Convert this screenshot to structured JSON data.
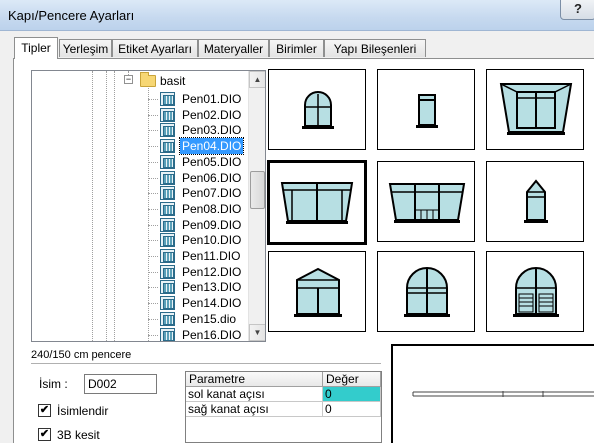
{
  "window": {
    "title": "Kapı/Pencere Ayarları",
    "help_label": "?"
  },
  "tabs": [
    {
      "label": "Tipler",
      "active": true
    },
    {
      "label": "Yerleşim"
    },
    {
      "label": "Etiket Ayarları"
    },
    {
      "label": "Materyaller"
    },
    {
      "label": "Birimler"
    },
    {
      "label": "Yapı Bileşenleri"
    }
  ],
  "tree": {
    "folder": {
      "label": "basit",
      "expander": "−"
    },
    "items": [
      "Pen01.DIO",
      "Pen02.DIO",
      "Pen03.DIO",
      "Pen04.DIO",
      "Pen05.DIO",
      "Pen06.DIO",
      "Pen07.DIO",
      "Pen08.DIO",
      "Pen09.DIO",
      "Pen10.DIO",
      "Pen11.DIO",
      "Pen12.DIO",
      "Pen13.DIO",
      "Pen14.DIO",
      "Pen15.dio",
      "Pen16.DIO"
    ],
    "selected_index": 3,
    "scroll_up": "▲",
    "scroll_down": "▼"
  },
  "thumbnails": [
    {
      "icon": "arched-window-small-icon"
    },
    {
      "icon": "small-window-icon"
    },
    {
      "icon": "bay-window-icon"
    },
    {
      "icon": "double-window-icon",
      "selected": true
    },
    {
      "icon": "triple-window-icon"
    },
    {
      "icon": "gabled-narrow-window-icon"
    },
    {
      "icon": "gabled-wide-window-icon"
    },
    {
      "icon": "arched-double-window-icon"
    },
    {
      "icon": "arched-shutter-window-icon"
    }
  ],
  "info": {
    "description": "240/150 cm pencere"
  },
  "form": {
    "name_label": "İsim :",
    "name_value": "D002",
    "checkbox_naming_label": "İsimlendir",
    "checkbox_naming_checked": "✔",
    "checkbox_3d_label": "3B kesit",
    "checkbox_3d_checked": "✔"
  },
  "param_table": {
    "headers": [
      "Parametre",
      "Değer"
    ],
    "rows": [
      [
        "sol kanat açısı",
        "0"
      ],
      [
        "sağ kanat açısı",
        "0"
      ]
    ]
  },
  "colors": {
    "selection": "#3399ff",
    "grid_highlight": "#33cccc",
    "glass": "#b7dfe3"
  }
}
